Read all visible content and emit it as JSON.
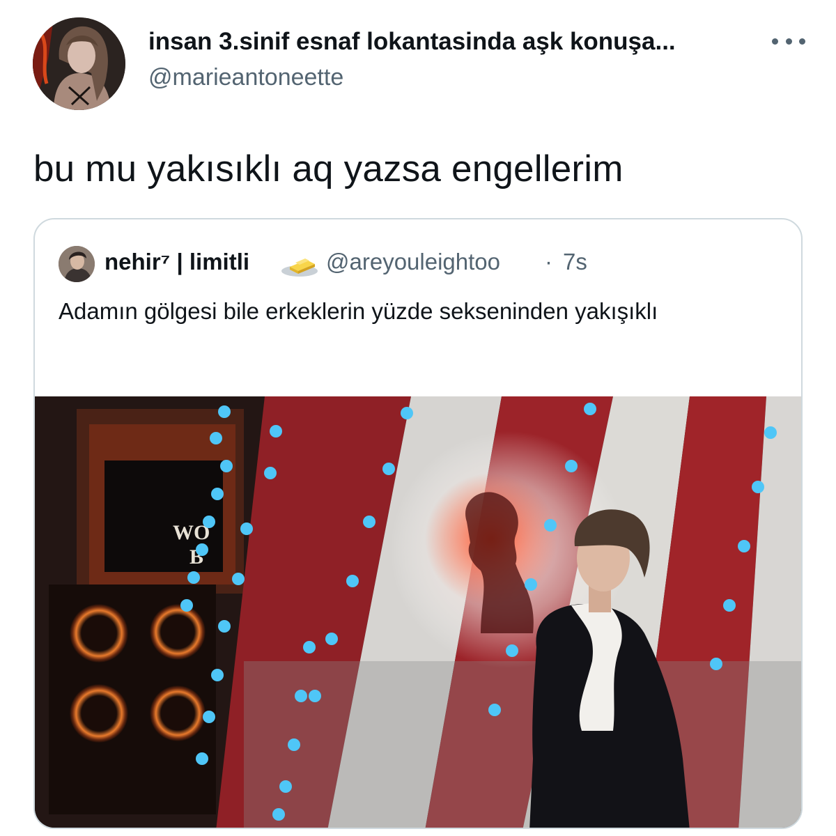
{
  "author": {
    "display_name": "insan 3.sinif esnaf lokantasinda aşk konuşa...",
    "handle": "@marieantoneette",
    "avatar_icon": "user-avatar"
  },
  "more_icon": "more-horizontal-icon",
  "tweet": {
    "text": "bu mu yakısıklı aq yazsa engellerim"
  },
  "quoted": {
    "display_name": "nehir⁷ | limitli",
    "emoji_icon": "butter-icon",
    "handle": "@areyouleightoo",
    "separator": "·",
    "time": "7s",
    "text": "Adamın gölgesi bile erkeklerin yüzde sekseninden yakışıklı",
    "media_icon": "photo-stage-portrait",
    "media_sign_text": "WO B"
  },
  "colors": {
    "text_primary": "#0f1419",
    "text_secondary": "#536471",
    "border": "#cfd9de",
    "stripe_red": "#9a2228",
    "stripe_light": "#d9d7d4",
    "bulb_blue": "#4fc6f7"
  }
}
